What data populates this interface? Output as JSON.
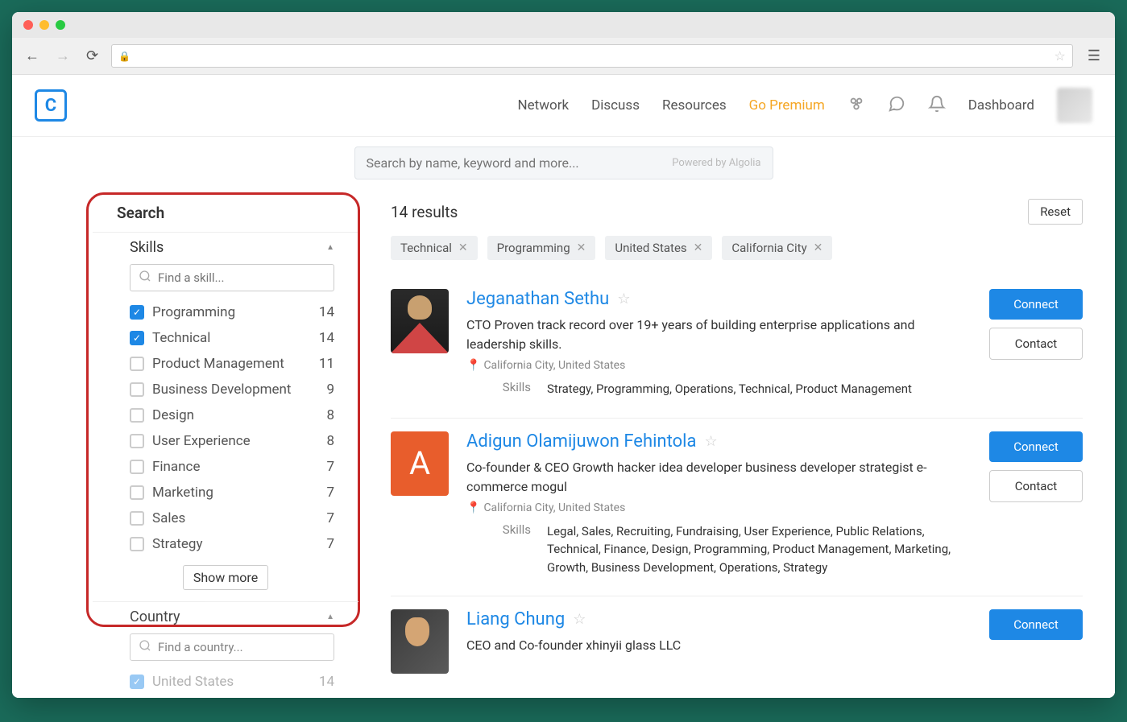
{
  "nav": {
    "network": "Network",
    "discuss": "Discuss",
    "resources": "Resources",
    "premium": "Go Premium",
    "dashboard": "Dashboard"
  },
  "search": {
    "placeholder": "Search by name, keyword and more...",
    "powered": "Powered by Algolia"
  },
  "sidebar": {
    "title": "Search",
    "skills": {
      "header": "Skills",
      "placeholder": "Find a skill...",
      "items": [
        {
          "label": "Programming",
          "count": "14",
          "checked": true
        },
        {
          "label": "Technical",
          "count": "14",
          "checked": true
        },
        {
          "label": "Product Management",
          "count": "11",
          "checked": false
        },
        {
          "label": "Business Development",
          "count": "9",
          "checked": false
        },
        {
          "label": "Design",
          "count": "8",
          "checked": false
        },
        {
          "label": "User Experience",
          "count": "8",
          "checked": false
        },
        {
          "label": "Finance",
          "count": "7",
          "checked": false
        },
        {
          "label": "Marketing",
          "count": "7",
          "checked": false
        },
        {
          "label": "Sales",
          "count": "7",
          "checked": false
        },
        {
          "label": "Strategy",
          "count": "7",
          "checked": false
        }
      ],
      "show_more": "Show more"
    },
    "country": {
      "header": "Country",
      "placeholder": "Find a country...",
      "items": [
        {
          "label": "United States",
          "count": "14",
          "checked": true
        }
      ]
    }
  },
  "results": {
    "count_label": "14 results",
    "reset": "Reset",
    "chips": [
      "Technical",
      "Programming",
      "United States",
      "California City"
    ],
    "connect_label": "Connect",
    "contact_label": "Contact",
    "skills_label": "Skills",
    "cards": [
      {
        "name": "Jeganathan Sethu",
        "desc": "CTO Proven track record over 19+ years of building enterprise applications and leadership skills.",
        "location": "California City, United States",
        "skills": "Strategy, Programming, Operations, Technical, Product Management"
      },
      {
        "name": "Adigun Olamijuwon Fehintola",
        "desc": "Co-founder & CEO Growth hacker idea developer business developer strategist e-commerce mogul",
        "location": "California City, United States",
        "skills": "Legal, Sales, Recruiting, Fundraising, User Experience, Public Relations, Technical, Finance, Design, Programming, Product Management, Marketing, Growth, Business Development, Operations, Strategy"
      },
      {
        "name": "Liang Chung",
        "desc": "CEO and Co-founder xhinyii glass LLC",
        "location": "",
        "skills": ""
      }
    ]
  }
}
